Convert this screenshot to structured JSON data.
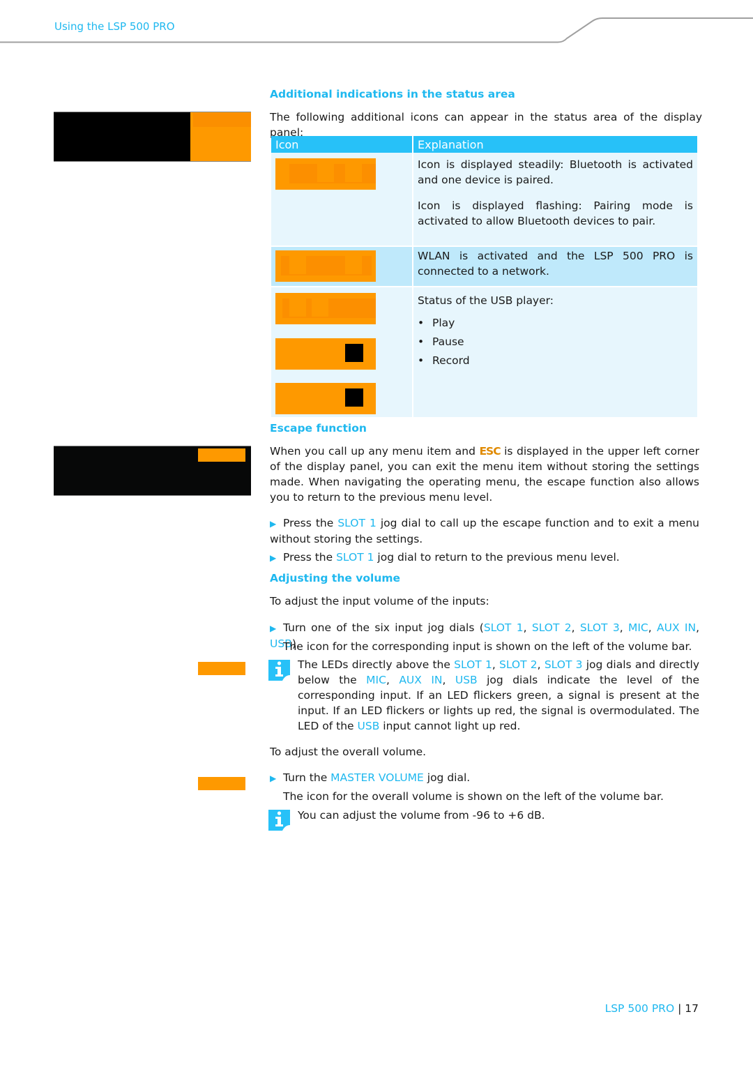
{
  "header": {
    "running_title": "Using the LSP 500 PRO"
  },
  "colors": {
    "accent_blue": "#1fb8ef",
    "table_header": "#27c1f8",
    "display_orange": "#fe9900",
    "esc_orange": "#e08a00"
  },
  "status_section": {
    "heading": "Additional indications in the status area",
    "intro": "The following additional icons can appear in the status area of the display panel:",
    "table": {
      "headers": [
        "Icon",
        "Explanation"
      ],
      "rows": [
        {
          "icon": "bluetooth-status-icon",
          "explanations": [
            "Icon is displayed steadily: Bluetooth is activated and one device is paired.",
            "Icon is displayed flashing: Pairing mode is activated to allow Bluetooth devices to pair."
          ]
        },
        {
          "icon": "wlan-status-icon",
          "explanations": [
            "WLAN is activated and the LSP 500 PRO is connected to a network."
          ]
        },
        {
          "icons": [
            "usb-play-icon",
            "usb-pause-icon",
            "usb-record-icon"
          ],
          "explanations": [
            "Status of the USB player:"
          ],
          "bullets": [
            "Play",
            "Pause",
            "Record"
          ]
        }
      ]
    }
  },
  "escape_section": {
    "heading": "Escape function",
    "para_before_esc": "When you call up any menu item and ",
    "esc_label": "ESC",
    "para_after_esc": " is displayed in the upper left corner of the display panel, you can exit the menu item without storing the settings made. When navigating the operating menu, the escape function also allows you to return to the previous menu level.",
    "steps": [
      {
        "pre": "Press the ",
        "key": "SLOT 1",
        "post": " jog dial to call up the escape function and to exit a menu without storing the settings."
      },
      {
        "pre": "Press the ",
        "key": "SLOT 1",
        "post": " jog dial to return to the previous menu level."
      }
    ]
  },
  "volume_section": {
    "heading": "Adjusting the volume",
    "intro_inputs": "To adjust the input volume of the inputs:",
    "step_inputs": {
      "pre": "Turn one of the six input jog dials (",
      "keys": [
        "SLOT 1",
        "SLOT 2",
        "SLOT 3",
        "MIC",
        "AUX IN",
        "USB"
      ],
      "post": ")."
    },
    "result_inputs": "The icon for the corresponding input is shown on the left of the volume bar.",
    "note_leds": {
      "t1": "The LEDs directly above the ",
      "k1": "SLOT 1",
      "k2": "SLOT 2",
      "k3": "SLOT 3",
      "t2": " jog dials and directly below the ",
      "k4": "MIC",
      "k5": "AUX IN",
      "k6": "USB",
      "t3": " jog dials indicate the level of the corresponding input. If an LED flickers green, a signal is present at the input. If an LED flickers or lights up red, the signal is overmodulated. The LED of the ",
      "k7": "USB",
      "t4": " input cannot light up red."
    },
    "intro_overall": "To adjust the overall volume.",
    "step_overall": {
      "pre": "Turn the ",
      "key": "MASTER VOLUME",
      "post": " jog dial."
    },
    "result_overall": "The icon for the overall volume is shown on the left of the volume bar.",
    "note_range": "You can adjust the volume from -96 to +6 dB."
  },
  "footer": {
    "product": "LSP 500 PRO",
    "separator": "|",
    "page_number": "17"
  }
}
